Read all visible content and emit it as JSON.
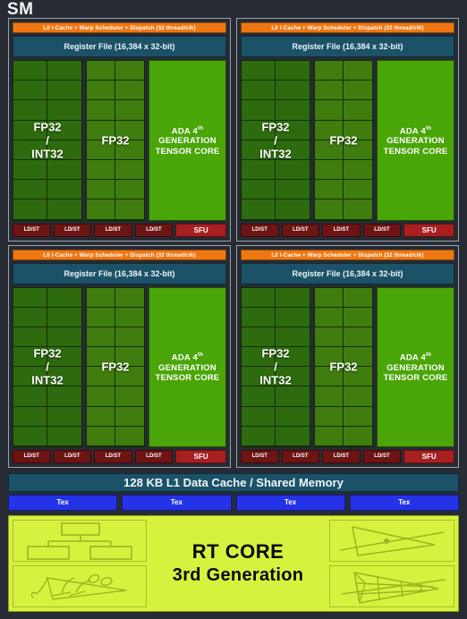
{
  "diagram": {
    "title": "SM",
    "subunit_count": 4,
    "colors": {
      "background": "#272c34",
      "scheduler_orange": "#ee7712",
      "register_file_teal": "#1b5268",
      "fp32_int32_green": "#2e6b0e",
      "fp32_green": "#3e7d0e",
      "tensor_core_green": "#4aa508",
      "ldst_red": "#6d1414",
      "sfu_red": "#a81f22",
      "tex_blue": "#2433e8",
      "rt_core_yellow": "#d7f23e"
    }
  },
  "processing_block": {
    "scheduler_label": "L0 i-Cache + Warp Scheduler + Dispatch (32 thread/clk)",
    "register_file_label": "Register File (16,384 x 32-bit)",
    "fp32_int32_label": "FP32\n/\nINT32",
    "fp32_int32_line1": "FP32",
    "fp32_int32_line2": "/",
    "fp32_int32_line3": "INT32",
    "fp32_int32_cells": 16,
    "fp32_label": "FP32",
    "fp32_cells": 16,
    "tensor_core_line1_pre": "ADA 4",
    "tensor_core_line1_sup": "th",
    "tensor_core_line2": "GENERATION",
    "tensor_core_line3": "TENSOR CORE",
    "ldst_label": "LD/ST",
    "ldst_count": 4,
    "sfu_label": "SFU"
  },
  "shared": {
    "l1_cache_label": "128 KB L1 Data Cache / Shared Memory",
    "tex_label": "Tex",
    "tex_count": 4
  },
  "rt_core": {
    "line1": "RT CORE",
    "line2": "3rd Generation",
    "illustrations": [
      "bvh-tree-icon",
      "ray-triangle-intersect-icon",
      "foliage-geometry-icon",
      "bvh-grid-triangle-icon"
    ]
  }
}
